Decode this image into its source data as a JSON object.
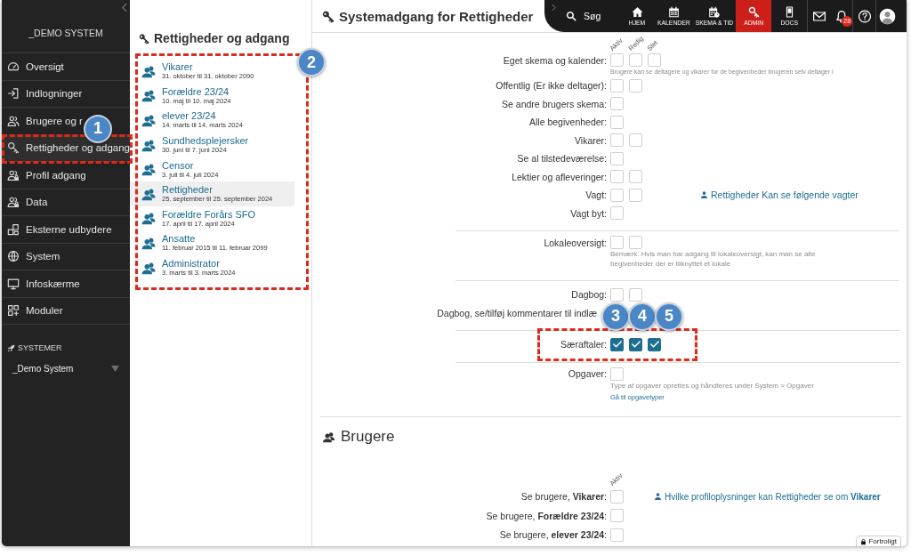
{
  "sidebar": {
    "title": "_DEMO SYSTEM",
    "items": [
      {
        "label": "Oversigt",
        "selected": false
      },
      {
        "label": "Indlogninger",
        "selected": false
      },
      {
        "label": "Brugere og r",
        "selected": false
      },
      {
        "label": "Rettigheder og adgang",
        "selected": true,
        "highlight": true,
        "callout": "1"
      },
      {
        "label": "Profil adgang",
        "selected": false
      },
      {
        "label": "Data",
        "selected": false
      },
      {
        "label": "Eksterne udbydere",
        "selected": false
      },
      {
        "label": "System",
        "selected": false
      },
      {
        "label": "Infoskærme",
        "selected": false
      },
      {
        "label": "Moduler",
        "selected": false
      }
    ],
    "systems_heading": "SYSTEMER",
    "system_select": {
      "value": "_Demo System"
    }
  },
  "roles_panel": {
    "title": "Rettigheder og adgang",
    "highlight": true,
    "callout": "2",
    "items": [
      {
        "name": "Vikarer",
        "dates": "31. oktober til 31. oktober 2090",
        "selected": false
      },
      {
        "name": "Forældre 23/24",
        "dates": "10. maj til 10. maj 2024",
        "selected": false
      },
      {
        "name": "elever 23/24",
        "dates": "14. marts til 14. marts 2024",
        "selected": false
      },
      {
        "name": "Sundhedsplejersker",
        "dates": "30. juni til 7. juni 2024",
        "selected": false
      },
      {
        "name": "Censor",
        "dates": "3. juli til 4. juli 2024",
        "selected": false
      },
      {
        "name": "Rettigheder",
        "dates": "25. september til 25. september 2024",
        "selected": true
      },
      {
        "name": "Forældre Forårs SFO",
        "dates": "17. april til 17. april 2024",
        "selected": false
      },
      {
        "name": "Ansatte",
        "dates": "11. februar 2015 til 11. februar 2099",
        "selected": false
      },
      {
        "name": "Administrator",
        "dates": "3. marts til 3. marts 2024",
        "selected": false
      }
    ]
  },
  "page_title": "Systemadgang for Rettigheder",
  "top_bar": {
    "search_label": "Søg",
    "nav": [
      {
        "label": "HJEM",
        "selected": false
      },
      {
        "label": "KALENDER",
        "selected": false
      },
      {
        "label": "SKEMA & TID",
        "selected": false
      },
      {
        "label": "ADMIN",
        "selected": true
      },
      {
        "label": "DOCS",
        "selected": false
      }
    ],
    "notification_count": "28"
  },
  "system_access": {
    "columns": [
      "Aktiv",
      "Redig",
      "Slet"
    ],
    "groups": [
      {
        "rows": [
          {
            "label": "Eget skema og kalender:",
            "checkboxes": [
              {
                "checked": false
              },
              {
                "checked": false
              },
              {
                "checked": false
              }
            ],
            "note": {
              "kind": "fine",
              "text": "Brugere kan se deltagere og vikarer for de begivenheder brugeren selv deltager i"
            }
          },
          {
            "label": "Offentlig (Er ikke deltager):",
            "checkboxes": [
              {
                "checked": false
              },
              {
                "checked": false
              }
            ]
          },
          {
            "label": "Se andre brugers skema:",
            "checkboxes": [
              {
                "checked": false
              }
            ]
          },
          {
            "label": "Alle begivenheder:",
            "checkboxes": [
              {
                "checked": false
              }
            ]
          },
          {
            "label": "Vikarer:",
            "checkboxes": [
              {
                "checked": false
              },
              {
                "checked": false
              }
            ]
          },
          {
            "label": "Se al tilstedeværelse:",
            "checkboxes": [
              {
                "checked": false
              }
            ]
          },
          {
            "label": "Lektier og afleveringer:",
            "checkboxes": [
              {
                "checked": false
              },
              {
                "checked": false
              }
            ]
          },
          {
            "label": "Vagt:",
            "checkboxes": [
              {
                "checked": false
              },
              {
                "checked": false
              }
            ],
            "link": "Rettigheder Kan se følgende vagter"
          },
          {
            "label": "Vagt byt:",
            "checkboxes": [
              {
                "checked": false
              }
            ]
          }
        ]
      },
      {
        "rows": [
          {
            "label": "Lokaleoversigt:",
            "checkboxes": [
              {
                "checked": false
              },
              {
                "checked": false
              }
            ],
            "note": {
              "kind": "remark",
              "text": "Bemærk: Hvis man har adgang til lokaleoversigt, kan man se alle begivenheder der er tilknyttet et lokale"
            }
          }
        ]
      },
      {
        "rows": [
          {
            "label": "Dagbog:",
            "checkboxes": [
              {
                "checked": false
              },
              {
                "checked": false
              }
            ]
          },
          {
            "label": "Dagbog, se/tilføj kommentarer til indlæ"
          }
        ]
      },
      {
        "rows": [
          {
            "label": "Særaftaler:",
            "highlight": true,
            "checkboxes": [
              {
                "checked": true,
                "callout": "3"
              },
              {
                "checked": true,
                "callout": "4"
              },
              {
                "checked": true,
                "callout": "5"
              }
            ]
          }
        ]
      },
      {
        "rows": [
          {
            "label": "Opgaver:",
            "checkboxes": [
              {
                "checked": false
              }
            ],
            "note": {
              "kind": "remark",
              "text": "Type af opgaver oprettes og håndteres under System > Opgaver"
            },
            "note_link": "Gå til opgavetyper"
          }
        ]
      }
    ]
  },
  "users_section": {
    "title": "Brugere",
    "columns": [
      "Aktiv"
    ],
    "rows": [
      {
        "label": "Se brugere, **Vikarer**:",
        "checkboxes": [
          {
            "checked": false
          }
        ],
        "link": "Hvilke profiloplysninger kan Rettigheder se om **Vikarer**"
      },
      {
        "label": "Se brugere, **Forældre 23/24**:",
        "checkboxes": [
          {
            "checked": false
          }
        ]
      },
      {
        "label": "Se brugere, **elever 23/24**:",
        "checkboxes": [
          {
            "checked": false
          }
        ]
      }
    ]
  },
  "confidential_label": "Fortroligt"
}
